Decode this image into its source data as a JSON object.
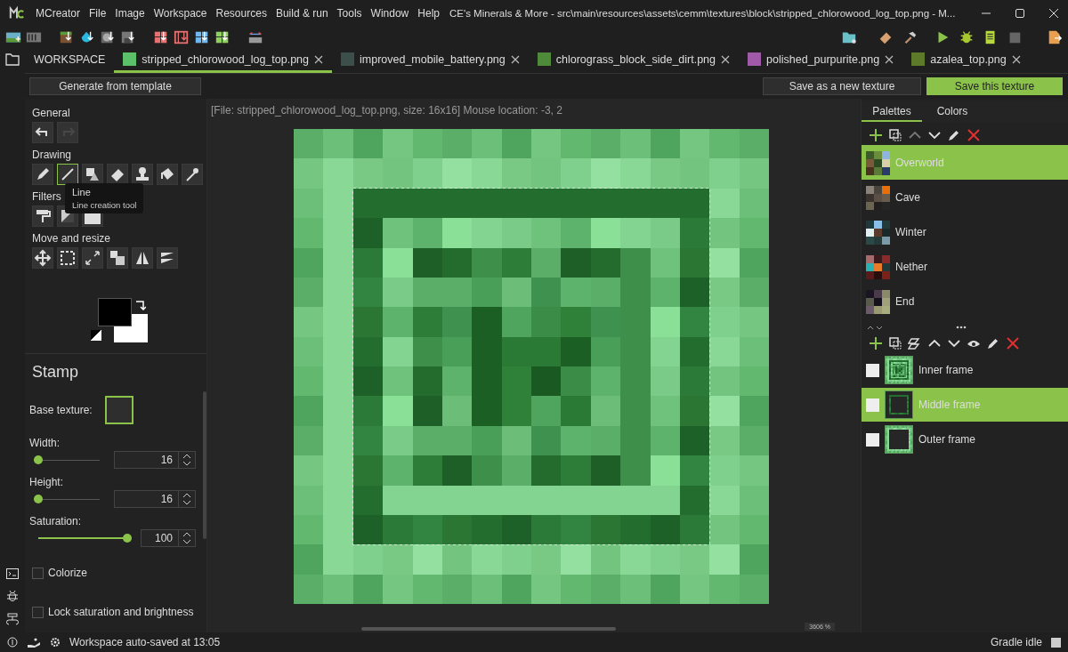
{
  "window": {
    "title": "CE's Minerals & More - src\\main\\resources\\assets\\cemm\\textures\\block\\stripped_chlorowood_log_top.png - M..."
  },
  "menu": [
    "MCreator",
    "File",
    "Image",
    "Workspace",
    "Resources",
    "Build & run",
    "Tools",
    "Window",
    "Help"
  ],
  "tabs": [
    {
      "label": "WORKSPACE",
      "kind": "workspace",
      "selected": false
    },
    {
      "label": "stripped_chlorowood_log_top.png",
      "kind": "file",
      "color": "#5cbf6a",
      "selected": true
    },
    {
      "label": "improved_mobile_battery.png",
      "kind": "file",
      "color": "#3d4f4a",
      "selected": false
    },
    {
      "label": "chlorograss_block_side_dirt.png",
      "kind": "file",
      "color": "#4f8a3a",
      "selected": false
    },
    {
      "label": "polished_purpurite.png",
      "kind": "file",
      "color": "#a05aa8",
      "selected": false
    },
    {
      "label": "azalea_top.png",
      "kind": "file",
      "color": "#5d7a2a",
      "selected": false
    }
  ],
  "actions": {
    "generate": "Generate from template",
    "save_new": "Save as a new texture",
    "save": "Save this texture"
  },
  "tool_sections": [
    {
      "title": "General",
      "tools": [
        {
          "kind": "undo",
          "selected": false,
          "disabled": false
        },
        {
          "kind": "redo",
          "selected": false,
          "disabled": true
        }
      ]
    },
    {
      "title": "Drawing",
      "tools": [
        {
          "kind": "pencil",
          "selected": false,
          "disabled": false
        },
        {
          "kind": "line",
          "selected": true,
          "disabled": false
        },
        {
          "kind": "shape",
          "selected": false,
          "disabled": false
        },
        {
          "kind": "eraser",
          "selected": false,
          "disabled": false
        },
        {
          "kind": "stamp",
          "selected": false,
          "disabled": false
        },
        {
          "kind": "fill",
          "selected": false,
          "disabled": false
        },
        {
          "kind": "picker",
          "selected": false,
          "disabled": false
        }
      ]
    },
    {
      "title": "Filters",
      "tools": [
        {
          "kind": "roller",
          "selected": false,
          "disabled": false
        },
        {
          "kind": "gradient",
          "selected": false,
          "disabled": false
        },
        {
          "kind": "tv",
          "selected": false,
          "disabled": false
        }
      ]
    },
    {
      "title": "Move and resize",
      "tools": [
        {
          "kind": "move",
          "selected": false,
          "disabled": false
        },
        {
          "kind": "select",
          "selected": false,
          "disabled": false
        },
        {
          "kind": "resize",
          "selected": false,
          "disabled": false
        },
        {
          "kind": "clone",
          "selected": false,
          "disabled": false
        },
        {
          "kind": "flip_h",
          "selected": false,
          "disabled": false
        },
        {
          "kind": "flip_v",
          "selected": false,
          "disabled": false
        }
      ]
    }
  ],
  "tooltip": {
    "title": "Line",
    "text": "Line creation tool"
  },
  "stamp": {
    "title": "Stamp",
    "base_texture": "Base texture:",
    "sliders": [
      {
        "label": "Width:",
        "level": 0,
        "value": "16"
      },
      {
        "label": "Height:",
        "level": 0,
        "value": "16"
      },
      {
        "label": "Saturation:",
        "level": 1,
        "value": "100"
      }
    ],
    "checkboxes": [
      {
        "label": "Colorize",
        "checked": false
      },
      {
        "label": "Lock saturation and brightness",
        "checked": false
      }
    ]
  },
  "canvas_info": "[File: stripped_chlorowood_log_top.png, size: 16x16] Mouse location: -3, 2",
  "zoom": "3606 %",
  "palette_tabs": [
    {
      "label": "Palettes",
      "selected": true
    },
    {
      "label": "Colors",
      "selected": false
    }
  ],
  "palettes": [
    {
      "name": "Overworld",
      "selected": true
    },
    {
      "name": "Cave",
      "selected": false
    },
    {
      "name": "Winter",
      "selected": false
    },
    {
      "name": "Nether",
      "selected": false
    },
    {
      "name": "End",
      "selected": false
    }
  ],
  "layers": [
    {
      "name": "Inner frame",
      "kind": "inner",
      "selected": false
    },
    {
      "name": "Middle frame",
      "kind": "middle",
      "selected": true
    },
    {
      "name": "Outer frame",
      "kind": "outer",
      "selected": false
    }
  ],
  "status": {
    "text": "Workspace auto-saved at 13:05",
    "gradle": "Gradle idle"
  }
}
